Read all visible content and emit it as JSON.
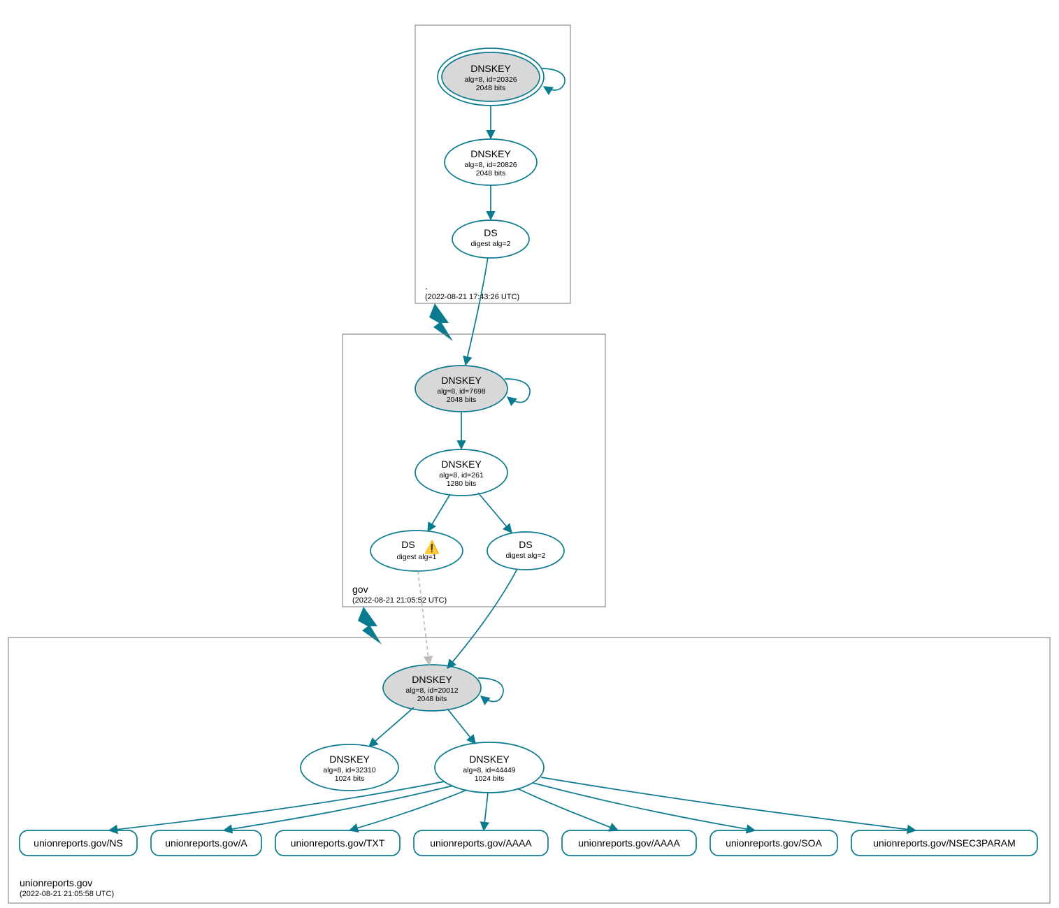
{
  "colors": {
    "stroke": "#0a7a8f",
    "ksk_fill": "#d8d8d8"
  },
  "zones": {
    "root": {
      "name": ".",
      "timestamp": "(2022-08-21 17:43:26 UTC)",
      "ksk": {
        "title": "DNSKEY",
        "line1": "alg=8, id=20326",
        "line2": "2048 bits"
      },
      "zsk": {
        "title": "DNSKEY",
        "line1": "alg=8, id=20826",
        "line2": "2048 bits"
      },
      "ds": {
        "title": "DS",
        "line1": "digest alg=2"
      }
    },
    "gov": {
      "name": "gov",
      "timestamp": "(2022-08-21 21:05:52 UTC)",
      "ksk": {
        "title": "DNSKEY",
        "line1": "alg=8, id=7698",
        "line2": "2048 bits"
      },
      "zsk": {
        "title": "DNSKEY",
        "line1": "alg=8, id=261",
        "line2": "1280 bits"
      },
      "ds1": {
        "title": "DS",
        "line1": "digest alg=1",
        "warning": true
      },
      "ds2": {
        "title": "DS",
        "line1": "digest alg=2"
      }
    },
    "domain": {
      "name": "unionreports.gov",
      "timestamp": "(2022-08-21 21:05:58 UTC)",
      "ksk": {
        "title": "DNSKEY",
        "line1": "alg=8, id=20012",
        "line2": "2048 bits"
      },
      "zsk1": {
        "title": "DNSKEY",
        "line1": "alg=8, id=32310",
        "line2": "1024 bits"
      },
      "zsk2": {
        "title": "DNSKEY",
        "line1": "alg=8, id=44449",
        "line2": "1024 bits"
      },
      "rrsets": [
        "unionreports.gov/NS",
        "unionreports.gov/A",
        "unionreports.gov/TXT",
        "unionreports.gov/AAAA",
        "unionreports.gov/AAAA",
        "unionreports.gov/SOA",
        "unionreports.gov/NSEC3PARAM"
      ]
    }
  }
}
